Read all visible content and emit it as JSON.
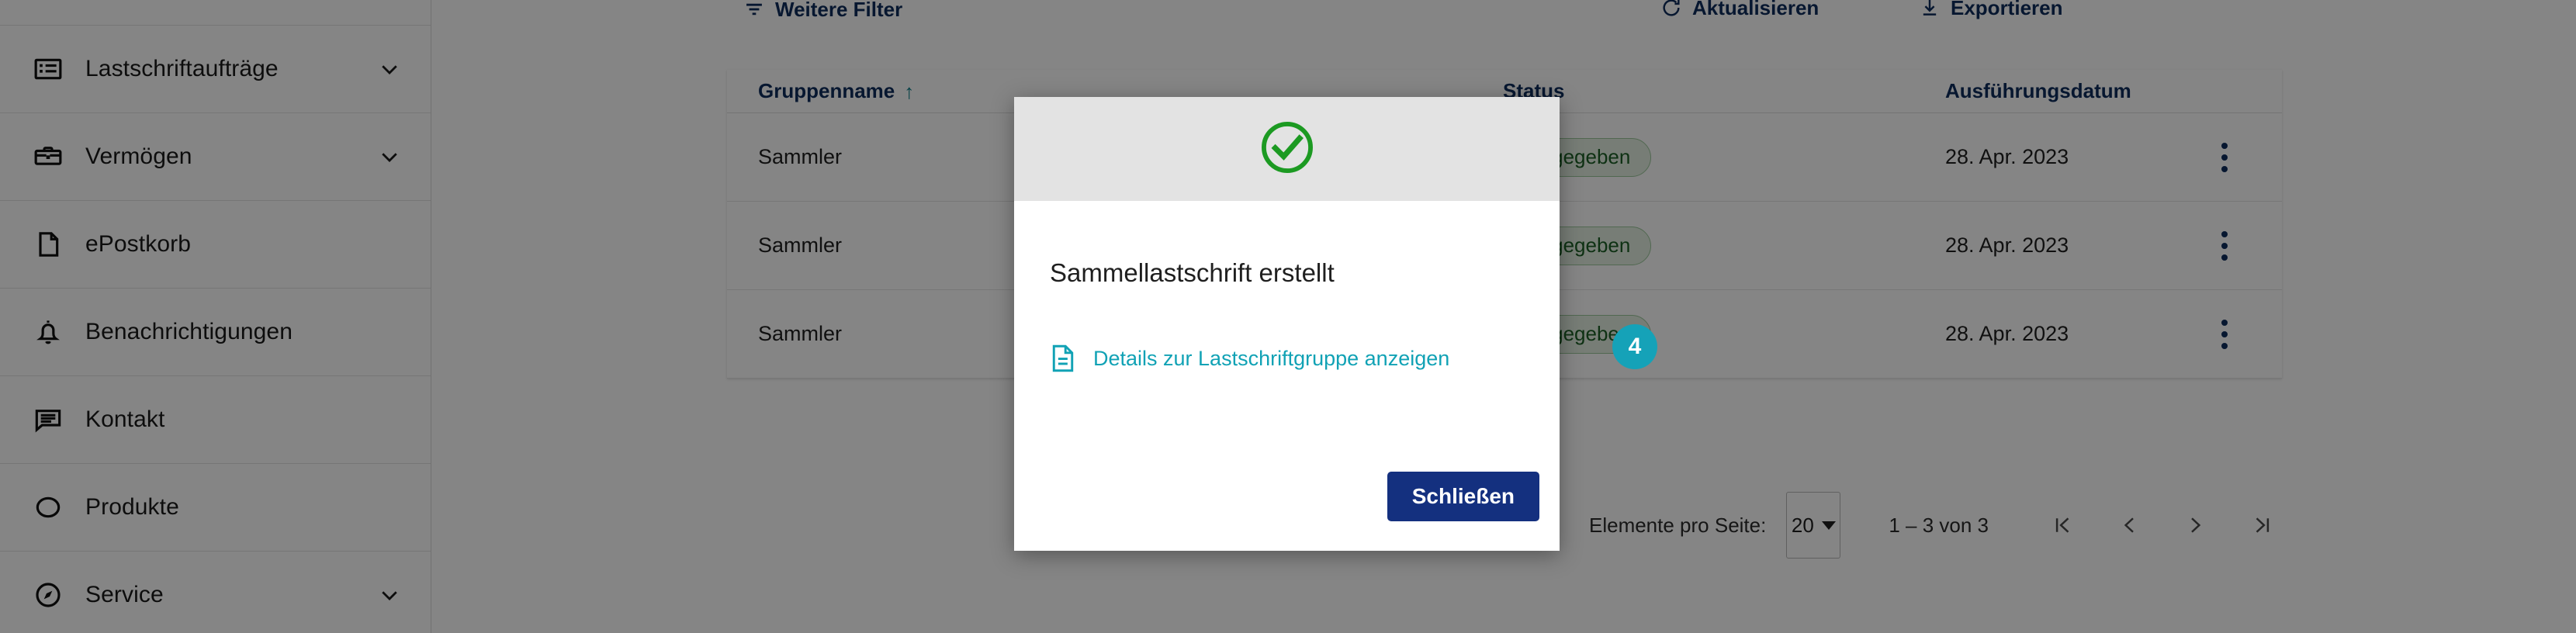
{
  "sidebar": {
    "items": [
      {
        "label": "Lastschriftaufträge",
        "icon": "list-box-icon",
        "expandable": true
      },
      {
        "label": "Vermögen",
        "icon": "briefcase-icon",
        "expandable": true
      },
      {
        "label": "ePostkorb",
        "icon": "document-icon",
        "expandable": false
      },
      {
        "label": "Benachrichtigungen",
        "icon": "bell-icon",
        "expandable": false
      },
      {
        "label": "Kontakt",
        "icon": "chat-icon",
        "expandable": false
      },
      {
        "label": "Produkte",
        "icon": "circle-icon",
        "expandable": false
      },
      {
        "label": "Service",
        "icon": "compass-icon",
        "expandable": true
      }
    ]
  },
  "toolbar": {
    "more_filters": "Weitere Filter",
    "refresh": "Aktualisieren",
    "export": "Exportieren"
  },
  "table": {
    "columns": [
      {
        "label": "Gruppenname",
        "sorted": true,
        "sort_arrow": "↑"
      },
      {
        "label": ""
      },
      {
        "label": "Status"
      },
      {
        "label": "Ausführungsdatum"
      },
      {
        "label": ""
      }
    ],
    "rows": [
      {
        "gruppenname": "Sammler",
        "status": "freigegeben",
        "ausfuehrungsdatum": "28. Apr. 2023"
      },
      {
        "gruppenname": "Sammler",
        "status": "freigegeben",
        "ausfuehrungsdatum": "28. Apr. 2023"
      },
      {
        "gruppenname": "Sammler",
        "status": "freigegeben",
        "ausfuehrungsdatum": "28. Apr. 2023"
      }
    ]
  },
  "pagination": {
    "items_per_page_label": "Elemente pro Seite:",
    "items_per_page_value": "20",
    "range": "1 – 3 von 3",
    "first_icon": "first-page-icon",
    "prev_icon": "previous-page-icon",
    "next_icon": "next-page-icon",
    "last_icon": "last-page-icon"
  },
  "modal": {
    "status_icon": "success-check-circle-icon",
    "title": "Sammellastschrift erstellt",
    "link_icon": "document-lines-icon",
    "link_text": "Details zur Lastschriftgruppe anzeigen",
    "close_button": "Schließen"
  },
  "click_marker": {
    "number": "4"
  },
  "colors": {
    "brand_navy": "#14307f",
    "header_navy": "#0f2d5c",
    "link_teal": "#11a2b5",
    "marker_teal": "#15a2b8",
    "success_green": "#1c9a22",
    "badge_bg": "#e4f0e2",
    "badge_text": "#1c5f26",
    "modal_header_bg": "#e3e3e3"
  }
}
